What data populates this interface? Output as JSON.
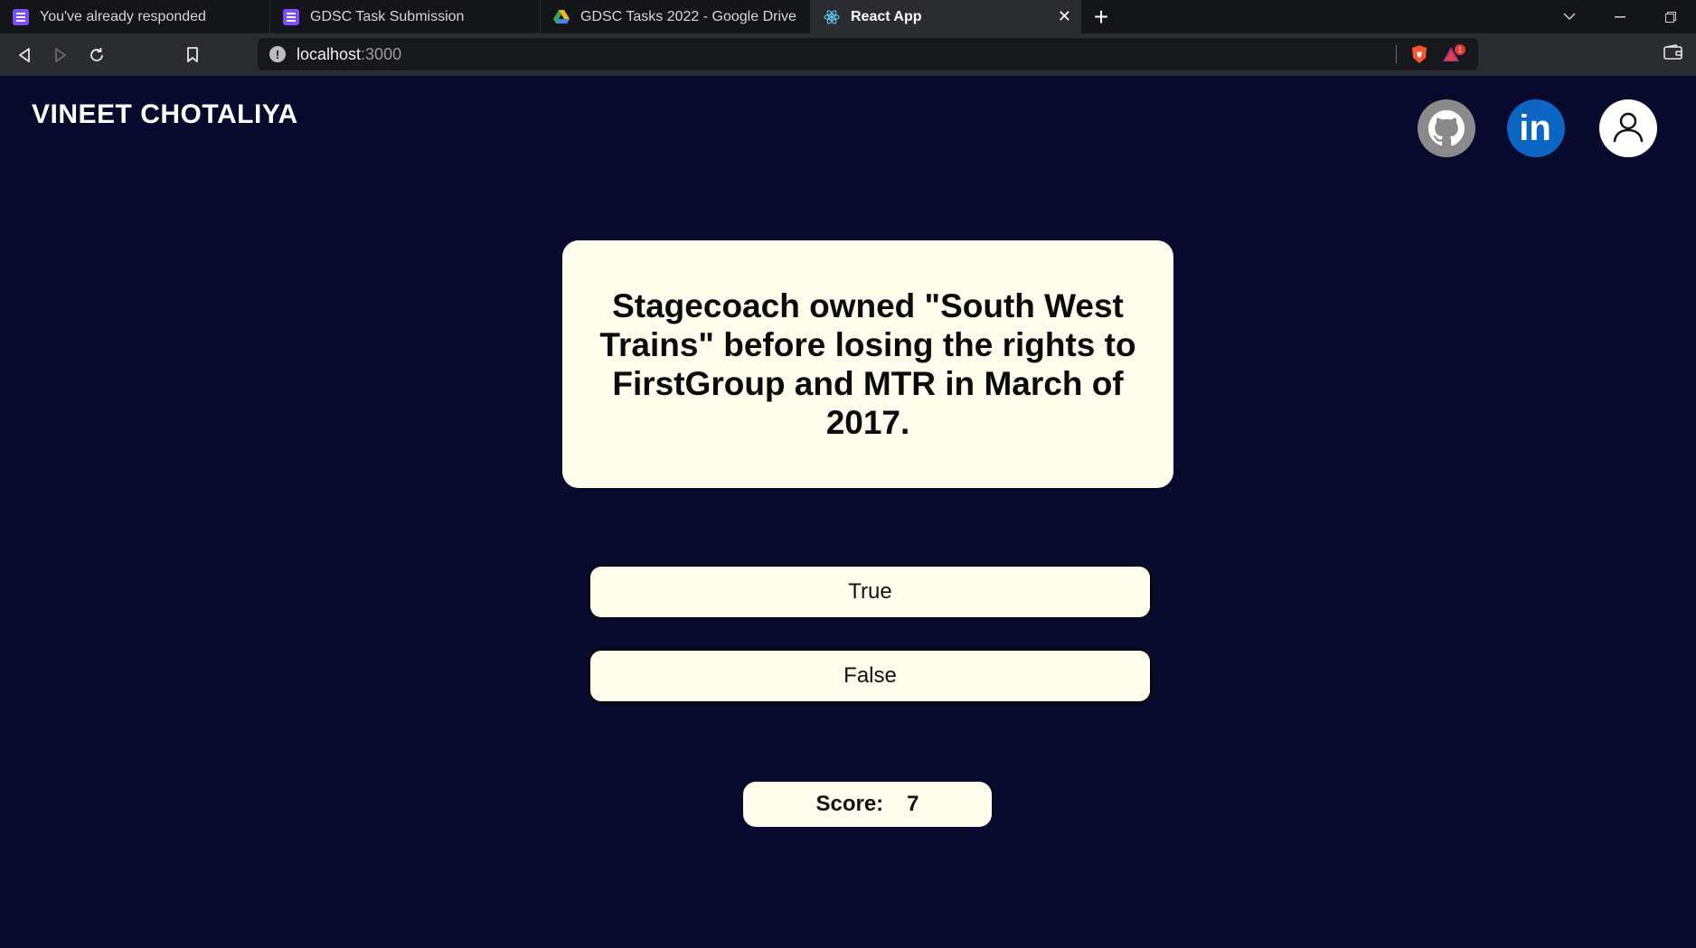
{
  "browser": {
    "tabs": [
      {
        "title": "You've already responded",
        "icon": "google-forms-icon",
        "active": false
      },
      {
        "title": "GDSC Task Submission",
        "icon": "google-forms-icon",
        "active": false
      },
      {
        "title": "GDSC Tasks 2022 - Google Drive",
        "icon": "google-drive-icon",
        "active": false
      },
      {
        "title": "React App",
        "icon": "react-icon",
        "active": true
      }
    ],
    "tab_close_glyph": "✕",
    "new_tab_glyph": "+",
    "address": {
      "host": "localhost",
      "port": ":3000"
    },
    "rewards_badge": "1"
  },
  "header": {
    "brand": "VINEET CHOTALIYA",
    "links": [
      "github-icon",
      "linkedin-icon",
      "profile-icon"
    ],
    "linkedin_glyph": "in"
  },
  "quiz": {
    "question": "Stagecoach owned \"South West Trains\" before losing the rights to FirstGroup and MTR in March of 2017.",
    "answers": {
      "true_label": "True",
      "false_label": "False"
    },
    "score_label": "Score:",
    "score_value": "7"
  },
  "colors": {
    "page_background": "#070a2d",
    "card_background": "#fffdeb",
    "linkedin_blue": "#0a66c2"
  }
}
